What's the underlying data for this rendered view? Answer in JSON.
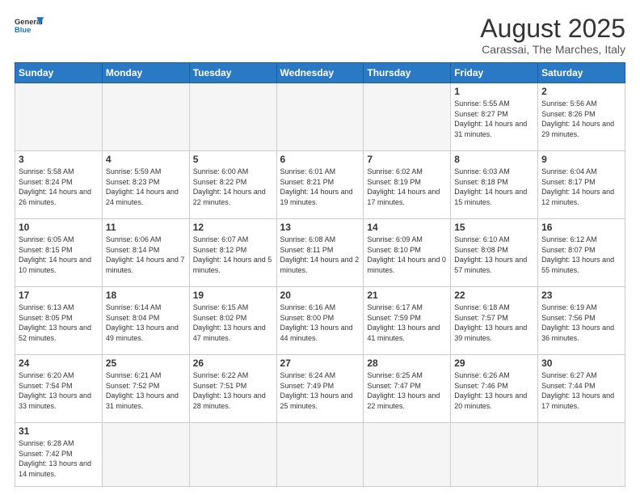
{
  "logo": {
    "general": "General",
    "blue": "Blue"
  },
  "title": {
    "month_year": "August 2025",
    "location": "Carassai, The Marches, Italy"
  },
  "weekdays": [
    "Sunday",
    "Monday",
    "Tuesday",
    "Wednesday",
    "Thursday",
    "Friday",
    "Saturday"
  ],
  "weeks": [
    [
      {
        "day": "",
        "info": ""
      },
      {
        "day": "",
        "info": ""
      },
      {
        "day": "",
        "info": ""
      },
      {
        "day": "",
        "info": ""
      },
      {
        "day": "",
        "info": ""
      },
      {
        "day": "1",
        "info": "Sunrise: 5:55 AM\nSunset: 8:27 PM\nDaylight: 14 hours and 31 minutes."
      },
      {
        "day": "2",
        "info": "Sunrise: 5:56 AM\nSunset: 8:26 PM\nDaylight: 14 hours and 29 minutes."
      }
    ],
    [
      {
        "day": "3",
        "info": "Sunrise: 5:58 AM\nSunset: 8:24 PM\nDaylight: 14 hours and 26 minutes."
      },
      {
        "day": "4",
        "info": "Sunrise: 5:59 AM\nSunset: 8:23 PM\nDaylight: 14 hours and 24 minutes."
      },
      {
        "day": "5",
        "info": "Sunrise: 6:00 AM\nSunset: 8:22 PM\nDaylight: 14 hours and 22 minutes."
      },
      {
        "day": "6",
        "info": "Sunrise: 6:01 AM\nSunset: 8:21 PM\nDaylight: 14 hours and 19 minutes."
      },
      {
        "day": "7",
        "info": "Sunrise: 6:02 AM\nSunset: 8:19 PM\nDaylight: 14 hours and 17 minutes."
      },
      {
        "day": "8",
        "info": "Sunrise: 6:03 AM\nSunset: 8:18 PM\nDaylight: 14 hours and 15 minutes."
      },
      {
        "day": "9",
        "info": "Sunrise: 6:04 AM\nSunset: 8:17 PM\nDaylight: 14 hours and 12 minutes."
      }
    ],
    [
      {
        "day": "10",
        "info": "Sunrise: 6:05 AM\nSunset: 8:15 PM\nDaylight: 14 hours and 10 minutes."
      },
      {
        "day": "11",
        "info": "Sunrise: 6:06 AM\nSunset: 8:14 PM\nDaylight: 14 hours and 7 minutes."
      },
      {
        "day": "12",
        "info": "Sunrise: 6:07 AM\nSunset: 8:12 PM\nDaylight: 14 hours and 5 minutes."
      },
      {
        "day": "13",
        "info": "Sunrise: 6:08 AM\nSunset: 8:11 PM\nDaylight: 14 hours and 2 minutes."
      },
      {
        "day": "14",
        "info": "Sunrise: 6:09 AM\nSunset: 8:10 PM\nDaylight: 14 hours and 0 minutes."
      },
      {
        "day": "15",
        "info": "Sunrise: 6:10 AM\nSunset: 8:08 PM\nDaylight: 13 hours and 57 minutes."
      },
      {
        "day": "16",
        "info": "Sunrise: 6:12 AM\nSunset: 8:07 PM\nDaylight: 13 hours and 55 minutes."
      }
    ],
    [
      {
        "day": "17",
        "info": "Sunrise: 6:13 AM\nSunset: 8:05 PM\nDaylight: 13 hours and 52 minutes."
      },
      {
        "day": "18",
        "info": "Sunrise: 6:14 AM\nSunset: 8:04 PM\nDaylight: 13 hours and 49 minutes."
      },
      {
        "day": "19",
        "info": "Sunrise: 6:15 AM\nSunset: 8:02 PM\nDaylight: 13 hours and 47 minutes."
      },
      {
        "day": "20",
        "info": "Sunrise: 6:16 AM\nSunset: 8:00 PM\nDaylight: 13 hours and 44 minutes."
      },
      {
        "day": "21",
        "info": "Sunrise: 6:17 AM\nSunset: 7:59 PM\nDaylight: 13 hours and 41 minutes."
      },
      {
        "day": "22",
        "info": "Sunrise: 6:18 AM\nSunset: 7:57 PM\nDaylight: 13 hours and 39 minutes."
      },
      {
        "day": "23",
        "info": "Sunrise: 6:19 AM\nSunset: 7:56 PM\nDaylight: 13 hours and 36 minutes."
      }
    ],
    [
      {
        "day": "24",
        "info": "Sunrise: 6:20 AM\nSunset: 7:54 PM\nDaylight: 13 hours and 33 minutes."
      },
      {
        "day": "25",
        "info": "Sunrise: 6:21 AM\nSunset: 7:52 PM\nDaylight: 13 hours and 31 minutes."
      },
      {
        "day": "26",
        "info": "Sunrise: 6:22 AM\nSunset: 7:51 PM\nDaylight: 13 hours and 28 minutes."
      },
      {
        "day": "27",
        "info": "Sunrise: 6:24 AM\nSunset: 7:49 PM\nDaylight: 13 hours and 25 minutes."
      },
      {
        "day": "28",
        "info": "Sunrise: 6:25 AM\nSunset: 7:47 PM\nDaylight: 13 hours and 22 minutes."
      },
      {
        "day": "29",
        "info": "Sunrise: 6:26 AM\nSunset: 7:46 PM\nDaylight: 13 hours and 20 minutes."
      },
      {
        "day": "30",
        "info": "Sunrise: 6:27 AM\nSunset: 7:44 PM\nDaylight: 13 hours and 17 minutes."
      }
    ],
    [
      {
        "day": "31",
        "info": "Sunrise: 6:28 AM\nSunset: 7:42 PM\nDaylight: 13 hours and 14 minutes."
      },
      {
        "day": "",
        "info": ""
      },
      {
        "day": "",
        "info": ""
      },
      {
        "day": "",
        "info": ""
      },
      {
        "day": "",
        "info": ""
      },
      {
        "day": "",
        "info": ""
      },
      {
        "day": "",
        "info": ""
      }
    ]
  ]
}
